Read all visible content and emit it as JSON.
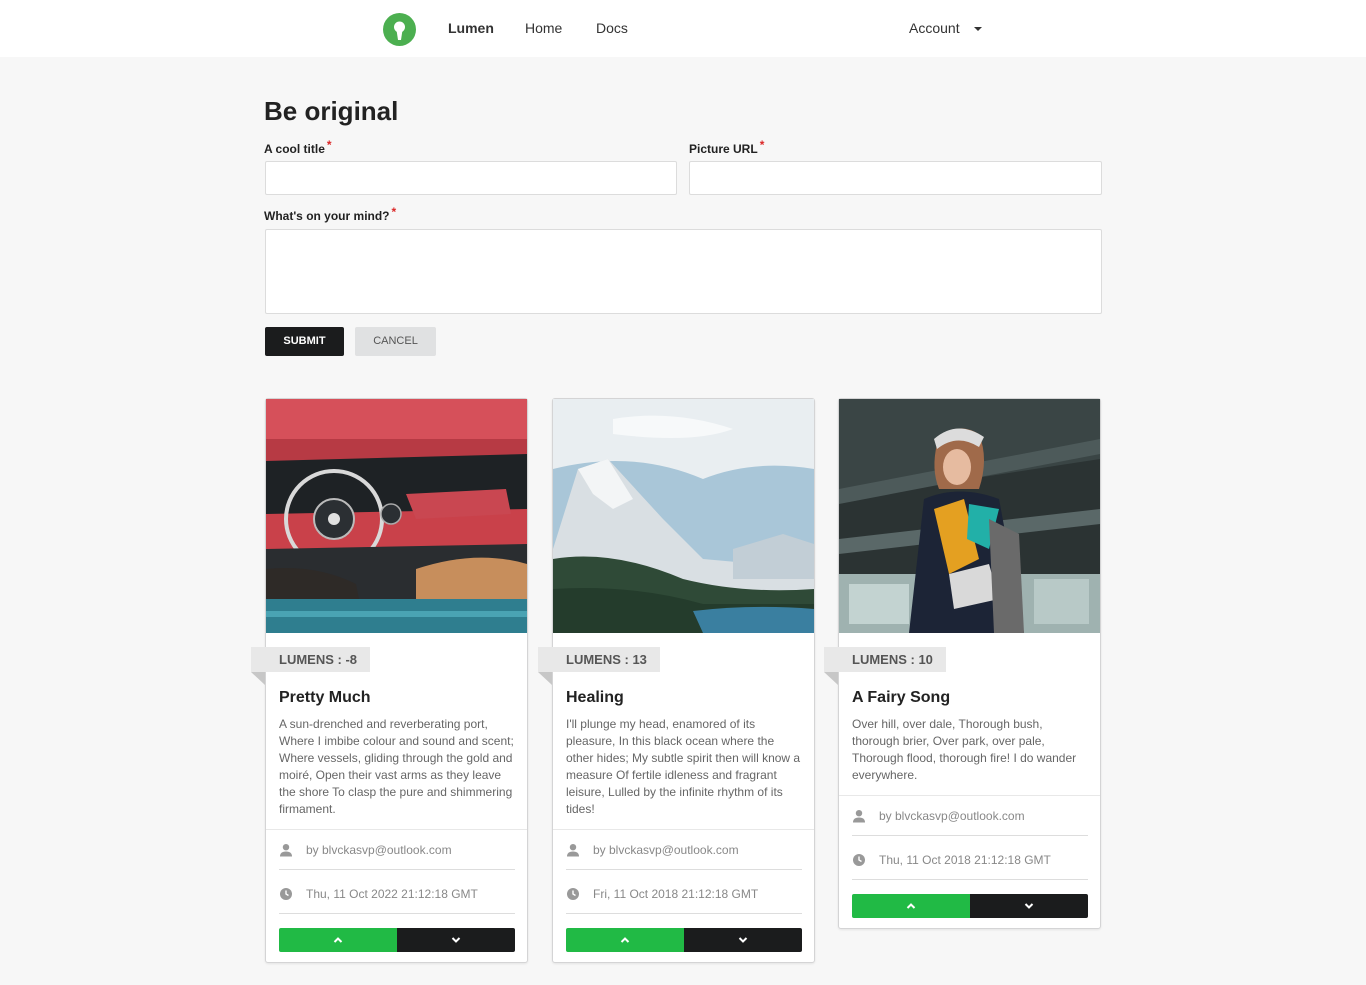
{
  "nav": {
    "brand": "Lumen",
    "home": "Home",
    "docs": "Docs",
    "account": "Account"
  },
  "form": {
    "title": "Be original",
    "title_label": "A cool title",
    "url_label": "Picture URL",
    "mind_label": "What's on your mind?",
    "required_mark": "*",
    "title_value": "",
    "url_value": "",
    "mind_value": "",
    "submit": "SUBMIT",
    "cancel": "CANCEL"
  },
  "posts": [
    {
      "lumens": "LUMENS : -8",
      "title": "Pretty Much",
      "body": "A sun-drenched and reverberating port, Where I imbibe colour and sound and scent; Where vessels, gliding through the gold and moiré, Open their vast arms as they leave the shore To clasp the pure and shimmering firmament.",
      "author": "by blvckasvp@outlook.com",
      "date": "Thu, 11 Oct 2022 21:12:18 GMT"
    },
    {
      "lumens": "LUMENS : 13",
      "title": "Healing",
      "body": "I'll plunge my head, enamored of its pleasure, In this black ocean where the other hides; My subtle spirit then will know a measure Of fertile idleness and fragrant leisure, Lulled by the infinite rhythm of its tides!",
      "author": "by blvckasvp@outlook.com",
      "date": "Fri, 11 Oct 2018 21:12:18 GMT"
    },
    {
      "lumens": "LUMENS : 10",
      "title": "A Fairy Song",
      "body": "Over hill, over dale, Thorough bush, thorough brier, Over park, over pale, Thorough flood, thorough fire! I do wander everywhere.",
      "author": "by blvckasvp@outlook.com",
      "date": "Thu, 11 Oct 2018 21:12:18 GMT"
    }
  ],
  "icons": {
    "logo": "lumen-logo-icon",
    "account_caret": "caret-down-icon",
    "author": "user-icon",
    "date": "clock-icon",
    "upvote": "chevron-up-icon",
    "downvote": "chevron-down-icon"
  },
  "colors": {
    "brand_green": "#4caf50",
    "upvote": "#21ba45",
    "downvote": "#1b1c1d",
    "required": "#db2828"
  }
}
